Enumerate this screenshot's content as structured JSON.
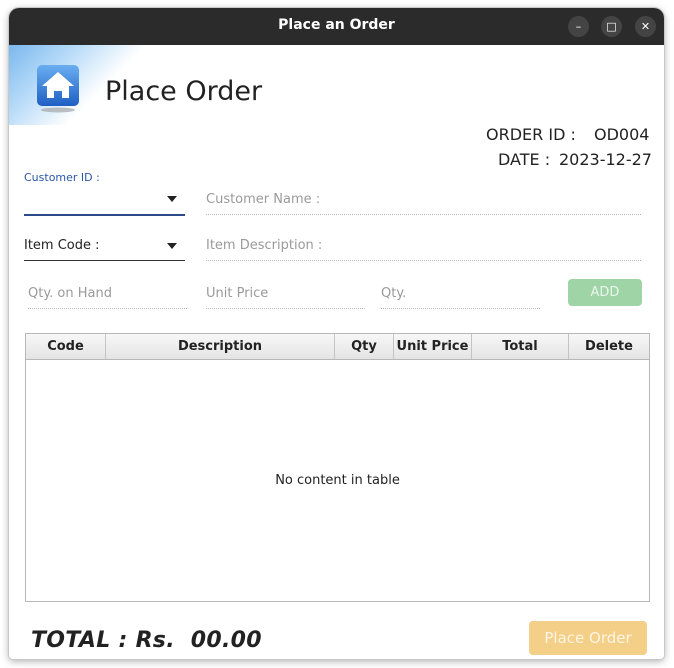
{
  "window": {
    "title": "Place an Order",
    "minimize_glyph": "–",
    "maximize_glyph": "□",
    "close_glyph": "✕"
  },
  "header": {
    "icon": "home-icon",
    "title": "Place Order",
    "order_id_label": "ORDER ID :",
    "order_id_value": "OD004",
    "date_label": "DATE :",
    "date_value": "2023-12-27"
  },
  "form": {
    "customer_id_label": "Customer ID :",
    "customer_name_placeholder": "Customer Name :",
    "item_code_label": "Item Code :",
    "item_description_placeholder": "Item Description :",
    "qty_on_hand_placeholder": "Qty. on Hand",
    "unit_price_placeholder": "Unit Price",
    "qty_placeholder": "Qty.",
    "add_label": "ADD"
  },
  "table": {
    "columns": [
      "Code",
      "Description",
      "Qty",
      "Unit Price",
      "Total",
      "Delete"
    ],
    "rows": [],
    "empty_text": "No content in table"
  },
  "footer": {
    "total_text": "TOTAL : Rs.  00.00",
    "place_order_label": "Place Order"
  },
  "colors": {
    "titlebar": "#2b2b2b",
    "add_button": "#9ed4a6",
    "place_order_button": "#f4cf88",
    "label_accent": "#2a56a8"
  }
}
